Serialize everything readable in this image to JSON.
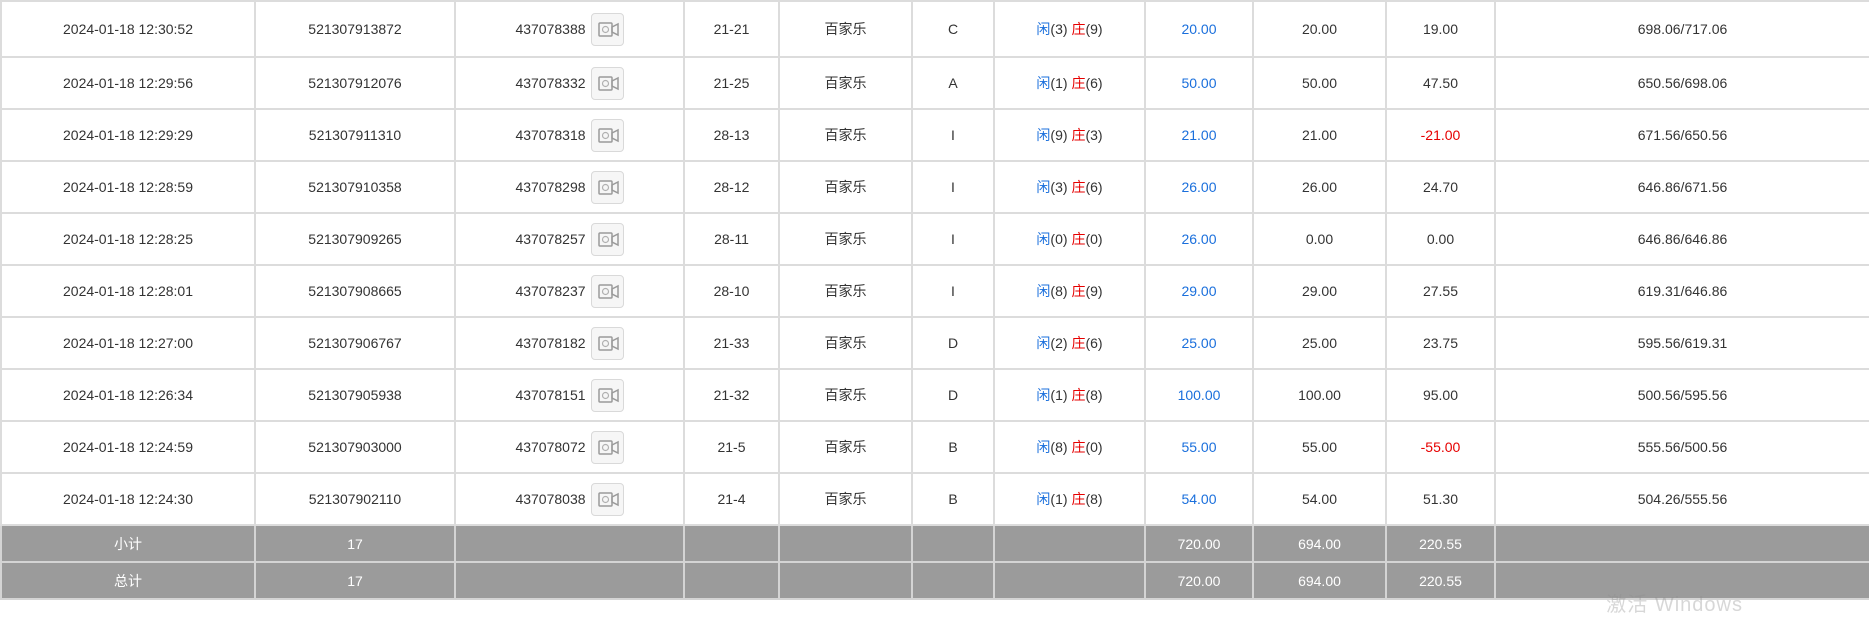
{
  "rows": [
    {
      "time": "2024-01-18 12:30:52",
      "order": "521307913872",
      "round": "437078388",
      "table_no": "21-21",
      "game": "百家乐",
      "seat": "C",
      "xian": "闲",
      "xian_pts": "(3)",
      "zhuang": "庄",
      "zhuang_pts": "(9)",
      "bet": "20.00",
      "valid": "20.00",
      "payout": "19.00",
      "balance": "698.06/717.06"
    },
    {
      "time": "2024-01-18 12:29:56",
      "order": "521307912076",
      "round": "437078332",
      "table_no": "21-25",
      "game": "百家乐",
      "seat": "A",
      "xian": "闲",
      "xian_pts": "(1)",
      "zhuang": "庄",
      "zhuang_pts": "(6)",
      "bet": "50.00",
      "valid": "50.00",
      "payout": "47.50",
      "balance": "650.56/698.06"
    },
    {
      "time": "2024-01-18 12:29:29",
      "order": "521307911310",
      "round": "437078318",
      "table_no": "28-13",
      "game": "百家乐",
      "seat": "I",
      "xian": "闲",
      "xian_pts": "(9)",
      "zhuang": "庄",
      "zhuang_pts": "(3)",
      "bet": "21.00",
      "valid": "21.00",
      "payout": "-21.00",
      "balance": "671.56/650.56"
    },
    {
      "time": "2024-01-18 12:28:59",
      "order": "521307910358",
      "round": "437078298",
      "table_no": "28-12",
      "game": "百家乐",
      "seat": "I",
      "xian": "闲",
      "xian_pts": "(3)",
      "zhuang": "庄",
      "zhuang_pts": "(6)",
      "bet": "26.00",
      "valid": "26.00",
      "payout": "24.70",
      "balance": "646.86/671.56"
    },
    {
      "time": "2024-01-18 12:28:25",
      "order": "521307909265",
      "round": "437078257",
      "table_no": "28-11",
      "game": "百家乐",
      "seat": "I",
      "xian": "闲",
      "xian_pts": "(0)",
      "zhuang": "庄",
      "zhuang_pts": "(0)",
      "bet": "26.00",
      "valid": "0.00",
      "payout": "0.00",
      "balance": "646.86/646.86"
    },
    {
      "time": "2024-01-18 12:28:01",
      "order": "521307908665",
      "round": "437078237",
      "table_no": "28-10",
      "game": "百家乐",
      "seat": "I",
      "xian": "闲",
      "xian_pts": "(8)",
      "zhuang": "庄",
      "zhuang_pts": "(9)",
      "bet": "29.00",
      "valid": "29.00",
      "payout": "27.55",
      "balance": "619.31/646.86"
    },
    {
      "time": "2024-01-18 12:27:00",
      "order": "521307906767",
      "round": "437078182",
      "table_no": "21-33",
      "game": "百家乐",
      "seat": "D",
      "xian": "闲",
      "xian_pts": "(2)",
      "zhuang": "庄",
      "zhuang_pts": "(6)",
      "bet": "25.00",
      "valid": "25.00",
      "payout": "23.75",
      "balance": "595.56/619.31"
    },
    {
      "time": "2024-01-18 12:26:34",
      "order": "521307905938",
      "round": "437078151",
      "table_no": "21-32",
      "game": "百家乐",
      "seat": "D",
      "xian": "闲",
      "xian_pts": "(1)",
      "zhuang": "庄",
      "zhuang_pts": "(8)",
      "bet": "100.00",
      "valid": "100.00",
      "payout": "95.00",
      "balance": "500.56/595.56"
    },
    {
      "time": "2024-01-18 12:24:59",
      "order": "521307903000",
      "round": "437078072",
      "table_no": "21-5",
      "game": "百家乐",
      "seat": "B",
      "xian": "闲",
      "xian_pts": "(8)",
      "zhuang": "庄",
      "zhuang_pts": "(0)",
      "bet": "55.00",
      "valid": "55.00",
      "payout": "-55.00",
      "balance": "555.56/500.56"
    },
    {
      "time": "2024-01-18 12:24:30",
      "order": "521307902110",
      "round": "437078038",
      "table_no": "21-4",
      "game": "百家乐",
      "seat": "B",
      "xian": "闲",
      "xian_pts": "(1)",
      "zhuang": "庄",
      "zhuang_pts": "(8)",
      "bet": "54.00",
      "valid": "54.00",
      "payout": "51.30",
      "balance": "504.26/555.56"
    }
  ],
  "subtotal": {
    "label": "小计",
    "count": "17",
    "bet": "720.00",
    "valid": "694.00",
    "payout": "220.55"
  },
  "total": {
    "label": "总计",
    "count": "17",
    "bet": "720.00",
    "valid": "694.00",
    "payout": "220.55"
  },
  "watermark": "激活 Windows",
  "icons": {
    "replay": "video-replay-icon"
  },
  "colors": {
    "blue": "#1a6fdc",
    "red": "#e60000",
    "summary_bg": "#9b9b9b"
  }
}
